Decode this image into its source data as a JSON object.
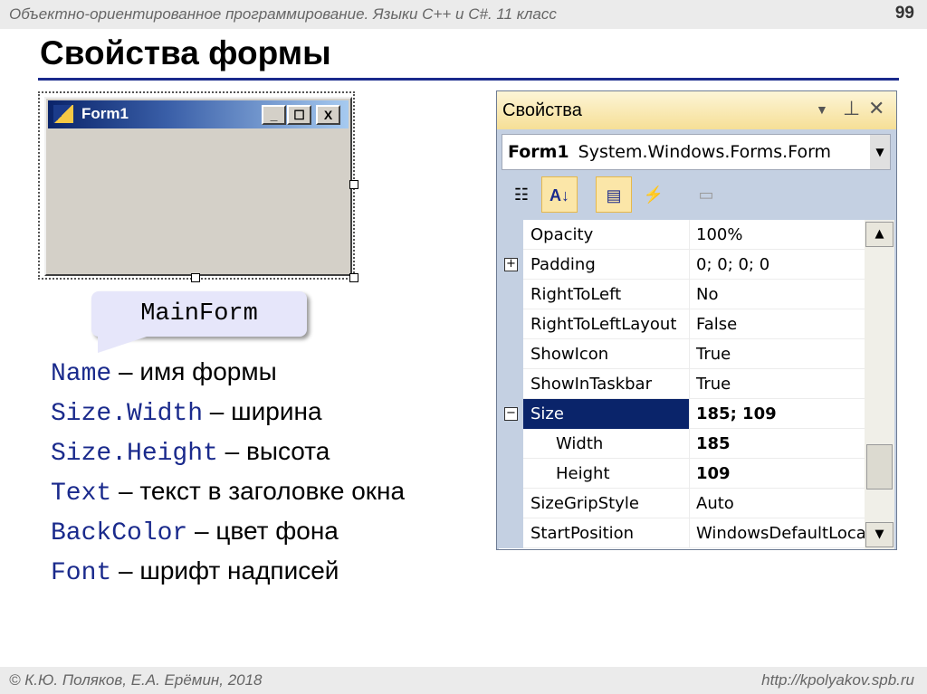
{
  "slide": {
    "header": "Объектно-ориентированное программирование. Языки C++ и C#. 11 класс",
    "page_number": "99",
    "title": "Свойства формы",
    "footer_left": "© К.Ю. Поляков, Е.А. Ерёмин, 2018",
    "footer_right": "http://kpolyakov.spb.ru"
  },
  "form": {
    "caption": "Form1",
    "min": "_",
    "max": "☐",
    "close": "X"
  },
  "bubble": "MainForm",
  "properties_list": [
    {
      "key": "Name",
      "desc": " – имя формы"
    },
    {
      "key": "Size.Width",
      "desc": " – ширина"
    },
    {
      "key": "Size.Height",
      "desc": " – высота"
    },
    {
      "key": "Text",
      "desc": " – текст в заголовке окна"
    },
    {
      "key": "BackColor",
      "desc": " – цвет фона"
    },
    {
      "key": "Font",
      "desc": " – шрифт надписей"
    }
  ],
  "panel": {
    "title": "Свойства",
    "object_name": "Form1",
    "object_type": "System.Windows.Forms.Form",
    "rows": [
      {
        "name": "Opacity",
        "value": "100%"
      },
      {
        "name": "Padding",
        "value": "0; 0; 0; 0",
        "expander": "+"
      },
      {
        "name": "RightToLeft",
        "value": "No"
      },
      {
        "name": "RightToLeftLayout",
        "value": "False"
      },
      {
        "name": "ShowIcon",
        "value": "True"
      },
      {
        "name": "ShowInTaskbar",
        "value": "True"
      },
      {
        "name": "Size",
        "value": "185; 109",
        "expander": "−"
      },
      {
        "name": "Width",
        "value": "185"
      },
      {
        "name": "Height",
        "value": "109"
      },
      {
        "name": "SizeGripStyle",
        "value": "Auto"
      },
      {
        "name": "StartPosition",
        "value": "WindowsDefaultLocation"
      }
    ]
  }
}
